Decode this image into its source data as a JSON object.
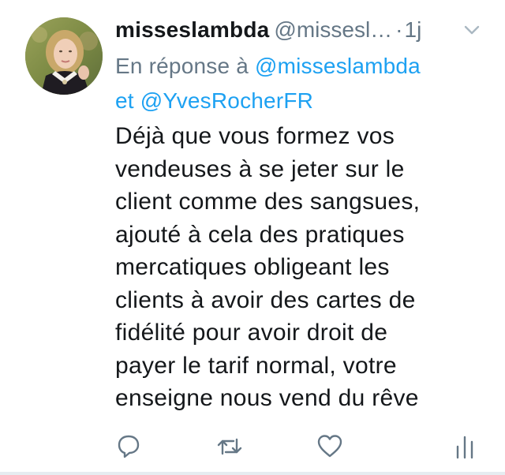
{
  "tweet": {
    "display_name": "misseslambda",
    "handle": "@missesl…",
    "separator": "·",
    "time": "1j",
    "reply_prefix": "En réponse à",
    "reply_mention_1": "@misseslambda",
    "reply_conjunction": "et",
    "reply_mention_2": "@YvesRocherFR",
    "body_lines": [
      "Déjà que vous formez vos",
      "vendeuses à se jeter sur le",
      "client comme des sangsues,",
      "ajouté à cela des pratiques",
      "mercatiques obligeant les",
      "clients à avoir des cartes de",
      "fidélité pour avoir droit de",
      "payer le tarif normal, votre",
      "enseigne nous vend du rêve"
    ]
  },
  "icons": {
    "menu": "chevron-down-icon",
    "reply": "reply-icon",
    "retweet": "retweet-icon",
    "like": "heart-icon",
    "stats": "stats-icon"
  },
  "colors": {
    "text": "#14171a",
    "secondary": "#657786",
    "link": "#1da1f2",
    "divider": "#e6ecf0"
  }
}
